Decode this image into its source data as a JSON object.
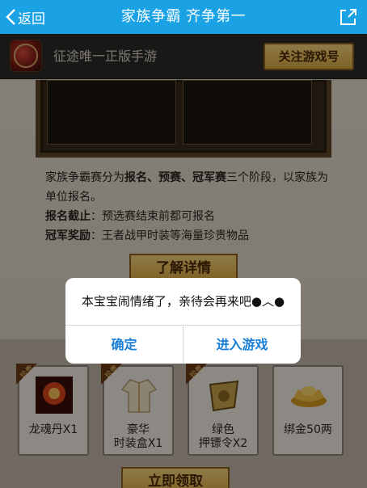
{
  "navbar": {
    "back_label": "返回",
    "title": "家族争霸 齐争第一",
    "share_icon": "share-icon",
    "color": "#1aa2e4"
  },
  "gamebar": {
    "app_icon": "game-logo-icon",
    "tagline": "征途唯一正版手游",
    "follow_label": "关注游戏号"
  },
  "content": {
    "desc_prefix": "家族争霸赛分为",
    "desc_bold": "报名、预赛、冠军赛",
    "desc_suffix": "三个阶段，以家族为单位报名。",
    "deadline_label": "报名截止",
    "deadline_text": "：预选赛结束前都可报名",
    "reward_label": "冠军奖励",
    "reward_text": "：王者战甲时装等海量珍贵物品",
    "learn_more_label": "了解详情"
  },
  "rewards": {
    "badge": "珍贵",
    "items": [
      {
        "label": "龙魂丹X1",
        "icon": "dragon-orb-icon"
      },
      {
        "label": "豪华\n时装盒X1",
        "icon": "costume-icon"
      },
      {
        "label": "绿色\n押镖令X2",
        "icon": "escort-token-icon"
      },
      {
        "label": "绑金50两",
        "icon": "gold-ingot-icon"
      }
    ],
    "claim_label": "立即领取"
  },
  "dialog": {
    "message": "本宝宝闹情绪了，亲待会再来吧●︿●",
    "confirm_label": "确定",
    "enter_game_label": "进入游戏",
    "accent": "#1a7fd6"
  }
}
